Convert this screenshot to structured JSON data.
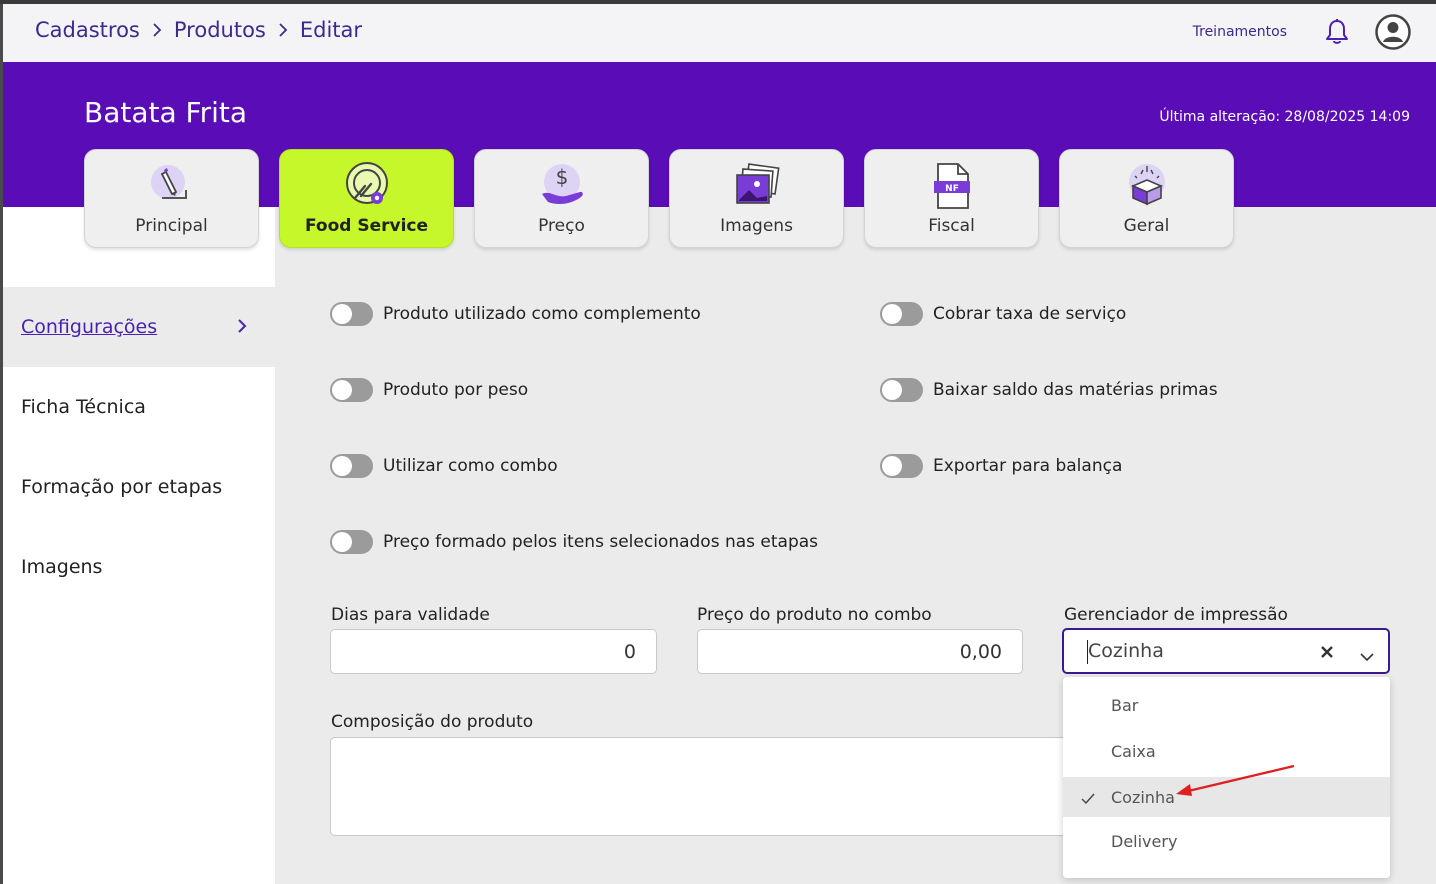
{
  "breadcrumb": [
    "Cadastros",
    "Produtos",
    "Editar"
  ],
  "header": {
    "trainings_link": "Treinamentos",
    "notification_icon": "bell-icon",
    "avatar_icon": "user-avatar-icon"
  },
  "product": {
    "title": "Batata Frita",
    "last_change": "Última alteração: 28/08/2025 14:09"
  },
  "tabs": [
    {
      "label": "Principal",
      "icon": "pencil-icon",
      "active": false
    },
    {
      "label": "Food Service",
      "icon": "food-service-icon",
      "active": true
    },
    {
      "label": "Preço",
      "icon": "money-hand-icon",
      "active": false
    },
    {
      "label": "Imagens",
      "icon": "images-icon",
      "active": false
    },
    {
      "label": "Fiscal",
      "icon": "nf-document-icon",
      "active": false
    },
    {
      "label": "Geral",
      "icon": "box-icon",
      "active": false
    }
  ],
  "sidebar": {
    "items": [
      {
        "label": "Configurações",
        "active": true
      },
      {
        "label": "Ficha Técnica",
        "active": false
      },
      {
        "label": "Formação por etapas",
        "active": false
      },
      {
        "label": "Imagens",
        "active": false
      }
    ]
  },
  "settings": {
    "toggles_left": [
      {
        "label": "Produto utilizado como complemento",
        "on": false
      },
      {
        "label": "Produto por peso",
        "on": false
      },
      {
        "label": "Utilizar como combo",
        "on": false
      },
      {
        "label": "Preço formado pelos itens selecionados nas etapas",
        "on": false
      }
    ],
    "toggles_right": [
      {
        "label": "Cobrar taxa de serviço",
        "on": false
      },
      {
        "label": "Baixar saldo das matérias primas",
        "on": false
      },
      {
        "label": "Exportar para balança",
        "on": false
      }
    ],
    "fields": {
      "validity_label": "Dias para validade",
      "validity_value": "0",
      "combo_price_label": "Preço do produto no combo",
      "combo_price_value": "0,00",
      "print_manager_label": "Gerenciador de impressão",
      "print_manager_value": "Cozinha",
      "composition_label": "Composição do produto",
      "composition_value": ""
    },
    "print_manager_options": [
      {
        "label": "Bar",
        "selected": false
      },
      {
        "label": "Caixa",
        "selected": false
      },
      {
        "label": "Cozinha",
        "selected": true
      },
      {
        "label": "Delivery",
        "selected": false
      }
    ]
  },
  "colors": {
    "brand_purple": "#5a0cb6",
    "active_tab": "#c6f72a",
    "annotation_arrow": "#e02020"
  }
}
